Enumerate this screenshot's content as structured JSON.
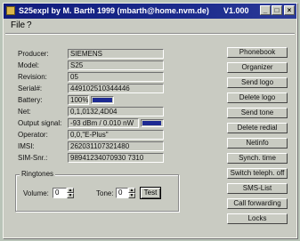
{
  "window": {
    "title": "S25expl by M. Barth 1999 (mbarth@home.nvm.de)",
    "version": "V1.000",
    "min_glyph": "_",
    "max_glyph": "□",
    "close_glyph": "×"
  },
  "menu": {
    "items": [
      "File",
      "?"
    ]
  },
  "fields": [
    {
      "label": "Producer:",
      "value": "SIEMENS"
    },
    {
      "label": "Model:",
      "value": "S25"
    },
    {
      "label": "Revision:",
      "value": "05"
    },
    {
      "label": "Serial#:",
      "value": "449102510344446"
    },
    {
      "label": "Battery:",
      "value": "100%",
      "level": 1.0
    },
    {
      "label": "Net:",
      "value": "0,1,0132,4D04"
    },
    {
      "label": "Output signal:",
      "value": "-93 dBm / 0.010 nW",
      "level": 0.95
    },
    {
      "label": "Operator:",
      "value": "0,0,\"E-Plus\""
    },
    {
      "label": "IMSI:",
      "value": "262031107321480"
    },
    {
      "label": "SIM-Snr.:",
      "value": "98941234070930 7310"
    }
  ],
  "buttons": [
    "Phonebook",
    "Organizer",
    "Send logo",
    "Delete logo",
    "Send tone",
    "Delete redial",
    "Netinfo",
    "Synch. time",
    "Switch teleph. off",
    "SMS-List",
    "Call forwarding",
    "Locks"
  ],
  "ringtones": {
    "title": "Ringtones",
    "volume_label": "Volume:",
    "volume_value": "0",
    "tone_label": "Tone:",
    "tone_value": "0",
    "test_label": "Test",
    "spin_up": "▲",
    "spin_down": "▼"
  }
}
